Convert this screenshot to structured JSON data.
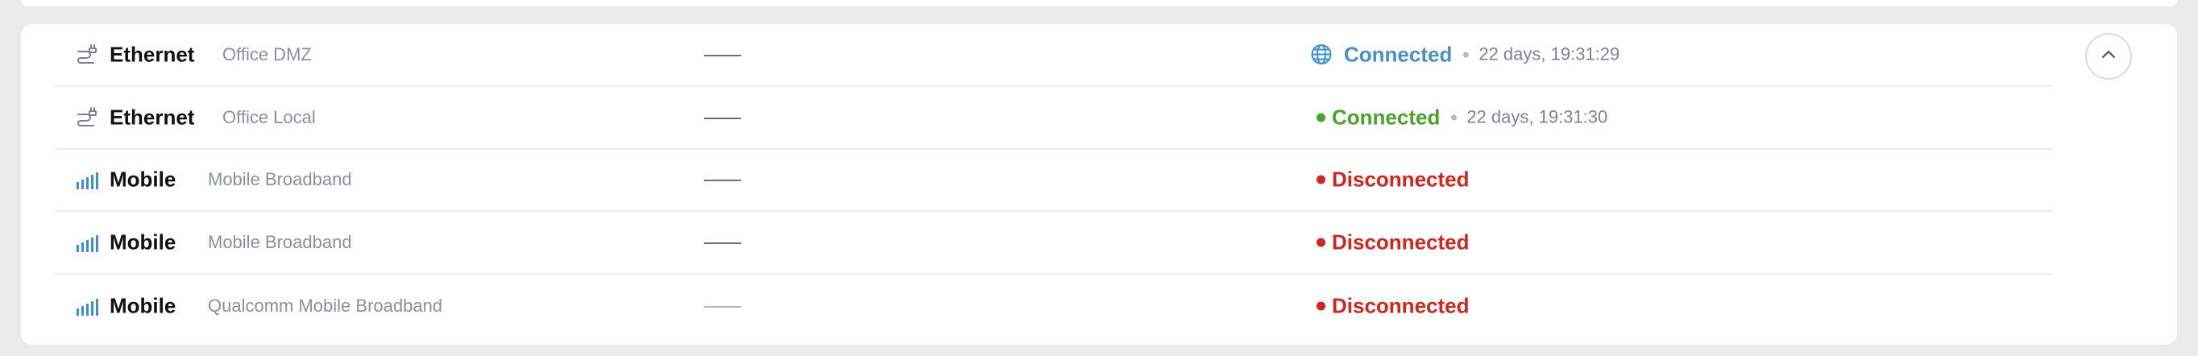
{
  "colors": {
    "connected_wan": "#4a90c8",
    "connected_lan": "#4aa32a",
    "disconnected": "#d0261e",
    "icon_blue": "#3b8fd4",
    "icon_gray": "#7a828a"
  },
  "interfaces": [
    {
      "type": "Ethernet",
      "type_icon": "ethernet-cable-icon",
      "name": "Office DMZ",
      "value": "—",
      "status": "Connected",
      "status_icon": "globe-icon",
      "uptime": "22 days, 19:31:29"
    },
    {
      "type": "Ethernet",
      "type_icon": "ethernet-cable-icon",
      "name": "Office Local",
      "value": "—",
      "status": "Connected",
      "status_icon": "green-dot",
      "uptime": "22 days, 19:31:30"
    },
    {
      "type": "Mobile",
      "type_icon": "signal-bars-icon",
      "name": "Mobile Broadband",
      "value": "—",
      "status": "Disconnected",
      "status_icon": "red-dot"
    },
    {
      "type": "Mobile",
      "type_icon": "signal-bars-icon",
      "name": "Mobile Broadband",
      "value": "—",
      "status": "Disconnected",
      "status_icon": "red-dot"
    },
    {
      "type": "Mobile",
      "type_icon": "signal-bars-icon",
      "name": "Qualcomm Mobile Broadband",
      "value": "—",
      "status": "Disconnected",
      "status_icon": "red-dot"
    }
  ],
  "collapse_button": {
    "icon": "chevron-up-icon"
  }
}
